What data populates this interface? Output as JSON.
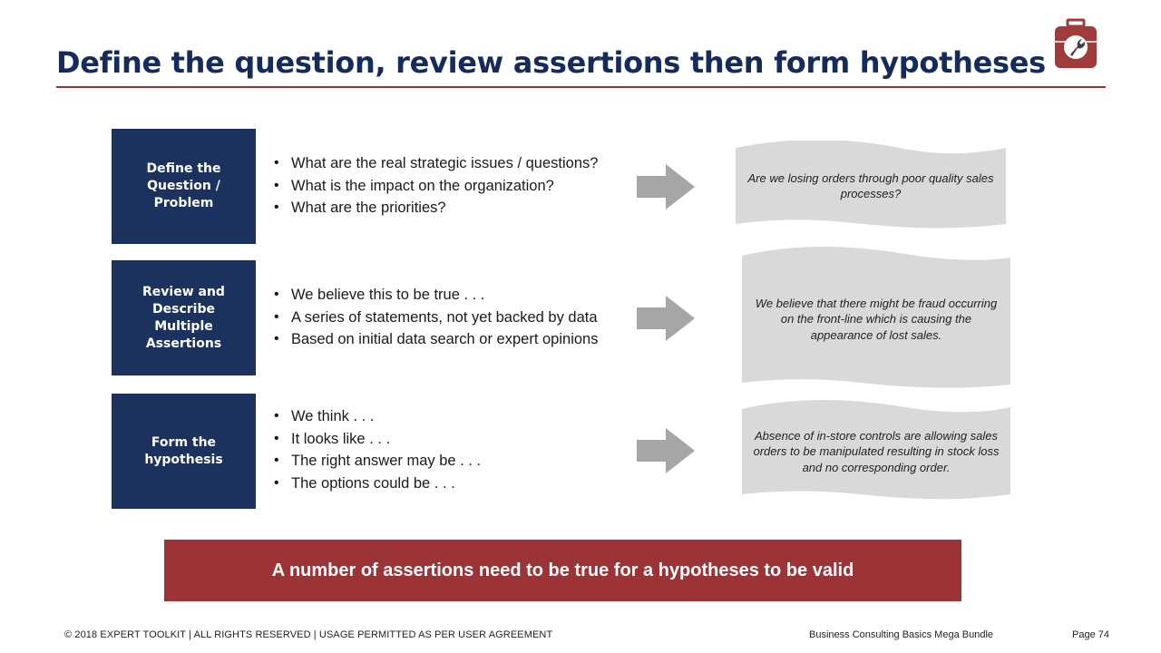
{
  "slide": {
    "title": "Define the question, review assertions then form hypotheses",
    "logo_icon": "toolkit-wrench-icon",
    "rows": [
      {
        "label": "Define the Question / Problem",
        "label_lines": [
          "Define the",
          "Question /",
          "Problem"
        ],
        "bullets": [
          "What are the real strategic issues / questions?",
          "What is the impact on the organization?",
          "What are the priorities?"
        ],
        "example": "Are we losing orders through  poor quality sales processes?"
      },
      {
        "label": "Review and Describe Multiple Assertions",
        "label_lines": [
          "Review and",
          "Describe Multiple",
          "Assertions"
        ],
        "bullets": [
          "We believe this to be true . . .",
          "A series of statements, not yet backed by data",
          "Based on initial data search or expert opinions"
        ],
        "example": "We believe that there might be fraud occurring on the front-line which is causing the appearance of lost sales."
      },
      {
        "label": "Form the hypothesis",
        "label_lines": [
          "Form the",
          "hypothesis"
        ],
        "bullets": [
          "We think . . .",
          "It looks like . . .",
          "The right answer may be . . .",
          "The options could be . . ."
        ],
        "example": "Absence of in-store controls are allowing sales orders to be manipulated resulting in stock loss and no corresponding order."
      }
    ],
    "banner": "A number of assertions need to be true for a hypotheses to be valid"
  },
  "footer": {
    "copyright": "© 2018 EXPERT TOOLKIT | ALL RIGHTS RESERVED | USAGE PERMITTED AS PER USER AGREEMENT",
    "bundle": "Business Consulting Basics Mega Bundle",
    "page": "Page 74"
  },
  "colors": {
    "title": "#152b5c",
    "box": "#1b325e",
    "accent": "#9b3337",
    "arrow": "#a6a6a6",
    "wave": "#d9d9d9"
  }
}
